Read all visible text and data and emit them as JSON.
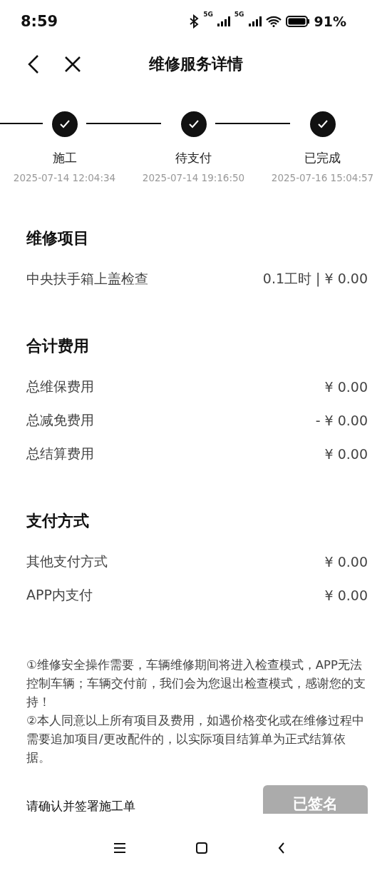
{
  "status_bar": {
    "time": "8:59",
    "network_1": "5G",
    "network_2": "5G",
    "battery": "91%"
  },
  "header": {
    "title": "维修服务详情"
  },
  "steps": [
    {
      "label": "施工",
      "time": "2025-07-14 12:04:34",
      "done": true
    },
    {
      "label": "待支付",
      "time": "2025-07-14 19:16:50",
      "done": true
    },
    {
      "label": "已完成",
      "time": "2025-07-16 15:04:57",
      "done": true
    }
  ],
  "sections": [
    {
      "title": "维修项目",
      "rows": [
        {
          "label": "中央扶手箱上盖检查",
          "value": "0.1工时 | ¥ 0.00"
        }
      ]
    },
    {
      "title": "合计费用",
      "rows": [
        {
          "label": "总维保费用",
          "value": "¥ 0.00"
        },
        {
          "label": "总减免费用",
          "value": "- ¥ 0.00"
        },
        {
          "label": "总结算费用",
          "value": "¥ 0.00"
        }
      ]
    },
    {
      "title": "支付方式",
      "rows": [
        {
          "label": "其他支付方式",
          "value": "¥ 0.00"
        },
        {
          "label": "APP内支付",
          "value": "¥ 0.00"
        }
      ]
    }
  ],
  "notes": [
    "①维修安全操作需要，车辆维修期间将进入检查模式，APP无法控制车辆；车辆交付前，我们会为您退出检查模式，感谢您的支持！",
    "②本人同意以上所有项目及费用，如遇价格变化或在维修过程中需要追加项目/更改配件的，以实际项目结算单为正式结算依据。"
  ],
  "footer": {
    "prompt": "请确认并签署施工单",
    "button": {
      "label": "已签名",
      "disabled": true
    }
  }
}
